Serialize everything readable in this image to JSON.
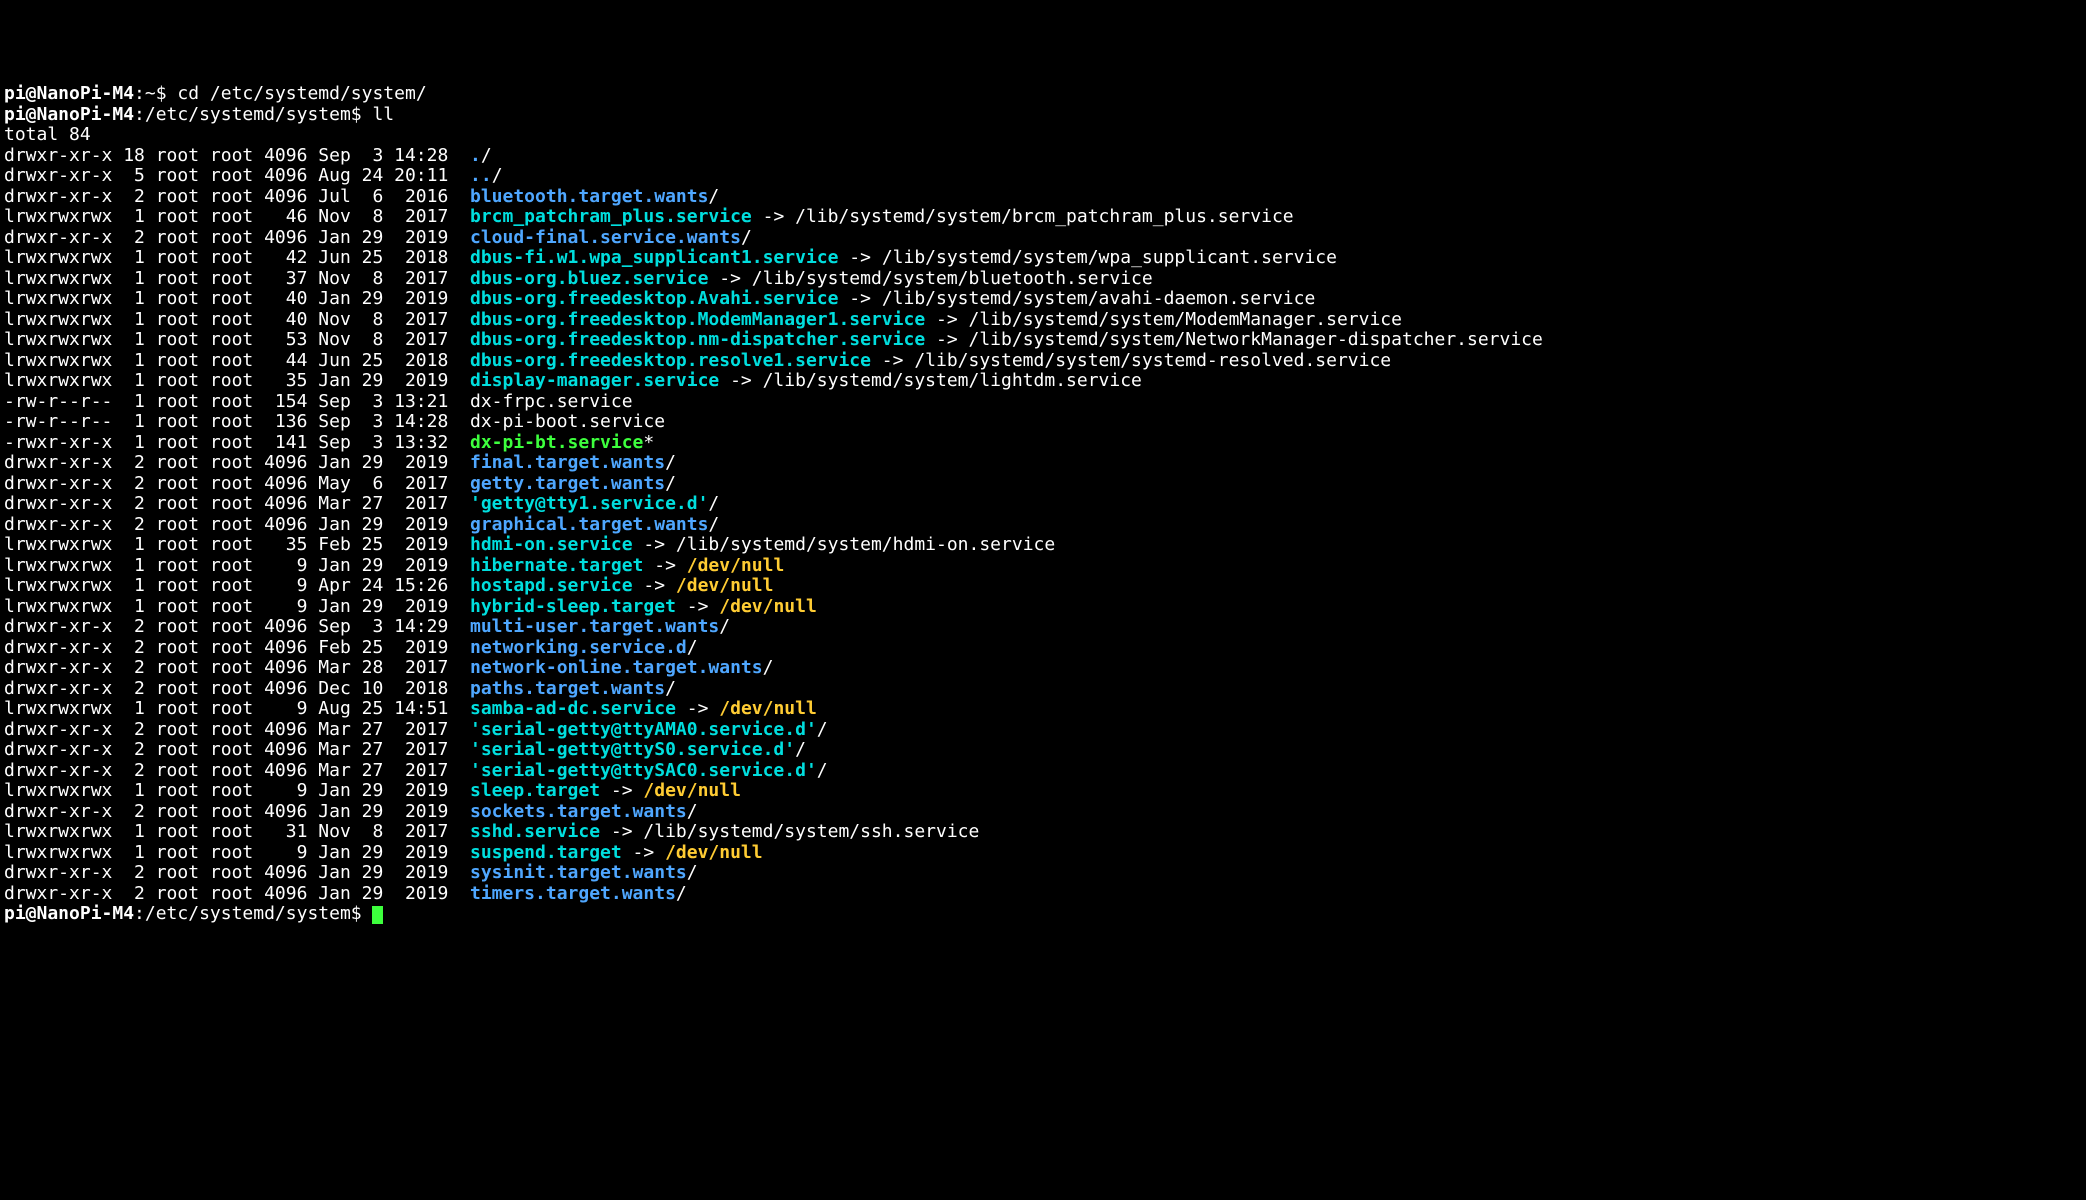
{
  "user": "pi",
  "host": "NanoPi-M4",
  "home_path": "~",
  "sys_path": "/etc/systemd/system",
  "cmd1": "cd /etc/systemd/system/",
  "cmd2": "ll",
  "total": "total 84",
  "rows": [
    {
      "perm": "drwxr-xr-x",
      "ln": "18",
      "own": "root",
      "grp": "root",
      "sz": "4096",
      "mo": "Sep",
      "d": " 3",
      "t": "14:28",
      "name": ".",
      "type": "dir",
      "suf": "/"
    },
    {
      "perm": "drwxr-xr-x",
      "ln": " 5",
      "own": "root",
      "grp": "root",
      "sz": "4096",
      "mo": "Aug",
      "d": "24",
      "t": "20:11",
      "name": "..",
      "type": "dir",
      "suf": "/"
    },
    {
      "perm": "drwxr-xr-x",
      "ln": " 2",
      "own": "root",
      "grp": "root",
      "sz": "4096",
      "mo": "Jul",
      "d": " 6",
      "t": " 2016",
      "name": "bluetooth.target.wants",
      "type": "dir",
      "suf": "/"
    },
    {
      "perm": "lrwxrwxrwx",
      "ln": " 1",
      "own": "root",
      "grp": "root",
      "sz": "  46",
      "mo": "Nov",
      "d": " 8",
      "t": " 2017",
      "name": "brcm_patchram_plus.service",
      "type": "link",
      "target": " -> /lib/systemd/system/brcm_patchram_plus.service"
    },
    {
      "perm": "drwxr-xr-x",
      "ln": " 2",
      "own": "root",
      "grp": "root",
      "sz": "4096",
      "mo": "Jan",
      "d": "29",
      "t": " 2019",
      "name": "cloud-final.service.wants",
      "type": "dir",
      "suf": "/"
    },
    {
      "perm": "lrwxrwxrwx",
      "ln": " 1",
      "own": "root",
      "grp": "root",
      "sz": "  42",
      "mo": "Jun",
      "d": "25",
      "t": " 2018",
      "name": "dbus-fi.w1.wpa_supplicant1.service",
      "type": "link",
      "target": " -> /lib/systemd/system/wpa_supplicant.service"
    },
    {
      "perm": "lrwxrwxrwx",
      "ln": " 1",
      "own": "root",
      "grp": "root",
      "sz": "  37",
      "mo": "Nov",
      "d": " 8",
      "t": " 2017",
      "name": "dbus-org.bluez.service",
      "type": "link",
      "target": " -> /lib/systemd/system/bluetooth.service"
    },
    {
      "perm": "lrwxrwxrwx",
      "ln": " 1",
      "own": "root",
      "grp": "root",
      "sz": "  40",
      "mo": "Jan",
      "d": "29",
      "t": " 2019",
      "name": "dbus-org.freedesktop.Avahi.service",
      "type": "link",
      "target": " -> /lib/systemd/system/avahi-daemon.service"
    },
    {
      "perm": "lrwxrwxrwx",
      "ln": " 1",
      "own": "root",
      "grp": "root",
      "sz": "  40",
      "mo": "Nov",
      "d": " 8",
      "t": " 2017",
      "name": "dbus-org.freedesktop.ModemManager1.service",
      "type": "link",
      "target": " -> /lib/systemd/system/ModemManager.service"
    },
    {
      "perm": "lrwxrwxrwx",
      "ln": " 1",
      "own": "root",
      "grp": "root",
      "sz": "  53",
      "mo": "Nov",
      "d": " 8",
      "t": " 2017",
      "name": "dbus-org.freedesktop.nm-dispatcher.service",
      "type": "link",
      "target": " -> /lib/systemd/system/NetworkManager-dispatcher.service"
    },
    {
      "perm": "lrwxrwxrwx",
      "ln": " 1",
      "own": "root",
      "grp": "root",
      "sz": "  44",
      "mo": "Jun",
      "d": "25",
      "t": " 2018",
      "name": "dbus-org.freedesktop.resolve1.service",
      "type": "link",
      "target": " -> /lib/systemd/system/systemd-resolved.service"
    },
    {
      "perm": "lrwxrwxrwx",
      "ln": " 1",
      "own": "root",
      "grp": "root",
      "sz": "  35",
      "mo": "Jan",
      "d": "29",
      "t": " 2019",
      "name": "display-manager.service",
      "type": "link",
      "target": " -> /lib/systemd/system/lightdm.service"
    },
    {
      "perm": "-rw-r--r--",
      "ln": " 1",
      "own": "root",
      "grp": "root",
      "sz": " 154",
      "mo": "Sep",
      "d": " 3",
      "t": "13:21",
      "name": "dx-frpc.service",
      "type": "file"
    },
    {
      "perm": "-rw-r--r--",
      "ln": " 1",
      "own": "root",
      "grp": "root",
      "sz": " 136",
      "mo": "Sep",
      "d": " 3",
      "t": "14:28",
      "name": "dx-pi-boot.service",
      "type": "file"
    },
    {
      "perm": "-rwxr-xr-x",
      "ln": " 1",
      "own": "root",
      "grp": "root",
      "sz": " 141",
      "mo": "Sep",
      "d": " 3",
      "t": "13:32",
      "name": "dx-pi-bt.service",
      "type": "exe",
      "suf": "*"
    },
    {
      "perm": "drwxr-xr-x",
      "ln": " 2",
      "own": "root",
      "grp": "root",
      "sz": "4096",
      "mo": "Jan",
      "d": "29",
      "t": " 2019",
      "name": "final.target.wants",
      "type": "dir",
      "suf": "/"
    },
    {
      "perm": "drwxr-xr-x",
      "ln": " 2",
      "own": "root",
      "grp": "root",
      "sz": "4096",
      "mo": "May",
      "d": " 6",
      "t": " 2017",
      "name": "getty.target.wants",
      "type": "dir",
      "suf": "/"
    },
    {
      "perm": "drwxr-xr-x",
      "ln": " 2",
      "own": "root",
      "grp": "root",
      "sz": "4096",
      "mo": "Mar",
      "d": "27",
      "t": " 2017",
      "name": "'getty@tty1.service.d'",
      "type": "quoted",
      "suf": "/"
    },
    {
      "perm": "drwxr-xr-x",
      "ln": " 2",
      "own": "root",
      "grp": "root",
      "sz": "4096",
      "mo": "Jan",
      "d": "29",
      "t": " 2019",
      "name": "graphical.target.wants",
      "type": "dir",
      "suf": "/"
    },
    {
      "perm": "lrwxrwxrwx",
      "ln": " 1",
      "own": "root",
      "grp": "root",
      "sz": "  35",
      "mo": "Feb",
      "d": "25",
      "t": " 2019",
      "name": "hdmi-on.service",
      "type": "link",
      "target": " -> /lib/systemd/system/hdmi-on.service"
    },
    {
      "perm": "lrwxrwxrwx",
      "ln": " 1",
      "own": "root",
      "grp": "root",
      "sz": "   9",
      "mo": "Jan",
      "d": "29",
      "t": " 2019",
      "name": "hibernate.target",
      "type": "link",
      "target": " -> ",
      "nulltarget": "/dev/null"
    },
    {
      "perm": "lrwxrwxrwx",
      "ln": " 1",
      "own": "root",
      "grp": "root",
      "sz": "   9",
      "mo": "Apr",
      "d": "24",
      "t": "15:26",
      "name": "hostapd.service",
      "type": "link",
      "target": " -> ",
      "nulltarget": "/dev/null"
    },
    {
      "perm": "lrwxrwxrwx",
      "ln": " 1",
      "own": "root",
      "grp": "root",
      "sz": "   9",
      "mo": "Jan",
      "d": "29",
      "t": " 2019",
      "name": "hybrid-sleep.target",
      "type": "link",
      "target": " -> ",
      "nulltarget": "/dev/null"
    },
    {
      "perm": "drwxr-xr-x",
      "ln": " 2",
      "own": "root",
      "grp": "root",
      "sz": "4096",
      "mo": "Sep",
      "d": " 3",
      "t": "14:29",
      "name": "multi-user.target.wants",
      "type": "dir",
      "suf": "/"
    },
    {
      "perm": "drwxr-xr-x",
      "ln": " 2",
      "own": "root",
      "grp": "root",
      "sz": "4096",
      "mo": "Feb",
      "d": "25",
      "t": " 2019",
      "name": "networking.service.d",
      "type": "dir",
      "suf": "/"
    },
    {
      "perm": "drwxr-xr-x",
      "ln": " 2",
      "own": "root",
      "grp": "root",
      "sz": "4096",
      "mo": "Mar",
      "d": "28",
      "t": " 2017",
      "name": "network-online.target.wants",
      "type": "dir",
      "suf": "/"
    },
    {
      "perm": "drwxr-xr-x",
      "ln": " 2",
      "own": "root",
      "grp": "root",
      "sz": "4096",
      "mo": "Dec",
      "d": "10",
      "t": " 2018",
      "name": "paths.target.wants",
      "type": "dir",
      "suf": "/"
    },
    {
      "perm": "lrwxrwxrwx",
      "ln": " 1",
      "own": "root",
      "grp": "root",
      "sz": "   9",
      "mo": "Aug",
      "d": "25",
      "t": "14:51",
      "name": "samba-ad-dc.service",
      "type": "link",
      "target": " -> ",
      "nulltarget": "/dev/null"
    },
    {
      "perm": "drwxr-xr-x",
      "ln": " 2",
      "own": "root",
      "grp": "root",
      "sz": "4096",
      "mo": "Mar",
      "d": "27",
      "t": " 2017",
      "name": "'serial-getty@ttyAMA0.service.d'",
      "type": "quoted",
      "suf": "/"
    },
    {
      "perm": "drwxr-xr-x",
      "ln": " 2",
      "own": "root",
      "grp": "root",
      "sz": "4096",
      "mo": "Mar",
      "d": "27",
      "t": " 2017",
      "name": "'serial-getty@ttyS0.service.d'",
      "type": "quoted",
      "suf": "/"
    },
    {
      "perm": "drwxr-xr-x",
      "ln": " 2",
      "own": "root",
      "grp": "root",
      "sz": "4096",
      "mo": "Mar",
      "d": "27",
      "t": " 2017",
      "name": "'serial-getty@ttySAC0.service.d'",
      "type": "quoted",
      "suf": "/"
    },
    {
      "perm": "lrwxrwxrwx",
      "ln": " 1",
      "own": "root",
      "grp": "root",
      "sz": "   9",
      "mo": "Jan",
      "d": "29",
      "t": " 2019",
      "name": "sleep.target",
      "type": "link",
      "target": " -> ",
      "nulltarget": "/dev/null"
    },
    {
      "perm": "drwxr-xr-x",
      "ln": " 2",
      "own": "root",
      "grp": "root",
      "sz": "4096",
      "mo": "Jan",
      "d": "29",
      "t": " 2019",
      "name": "sockets.target.wants",
      "type": "dir",
      "suf": "/"
    },
    {
      "perm": "lrwxrwxrwx",
      "ln": " 1",
      "own": "root",
      "grp": "root",
      "sz": "  31",
      "mo": "Nov",
      "d": " 8",
      "t": " 2017",
      "name": "sshd.service",
      "type": "link",
      "target": " -> /lib/systemd/system/ssh.service"
    },
    {
      "perm": "lrwxrwxrwx",
      "ln": " 1",
      "own": "root",
      "grp": "root",
      "sz": "   9",
      "mo": "Jan",
      "d": "29",
      "t": " 2019",
      "name": "suspend.target",
      "type": "link",
      "target": " -> ",
      "nulltarget": "/dev/null"
    },
    {
      "perm": "drwxr-xr-x",
      "ln": " 2",
      "own": "root",
      "grp": "root",
      "sz": "4096",
      "mo": "Jan",
      "d": "29",
      "t": " 2019",
      "name": "sysinit.target.wants",
      "type": "dir",
      "suf": "/"
    },
    {
      "perm": "drwxr-xr-x",
      "ln": " 2",
      "own": "root",
      "grp": "root",
      "sz": "4096",
      "mo": "Jan",
      "d": "29",
      "t": " 2019",
      "name": "timers.target.wants",
      "type": "dir",
      "suf": "/"
    }
  ]
}
